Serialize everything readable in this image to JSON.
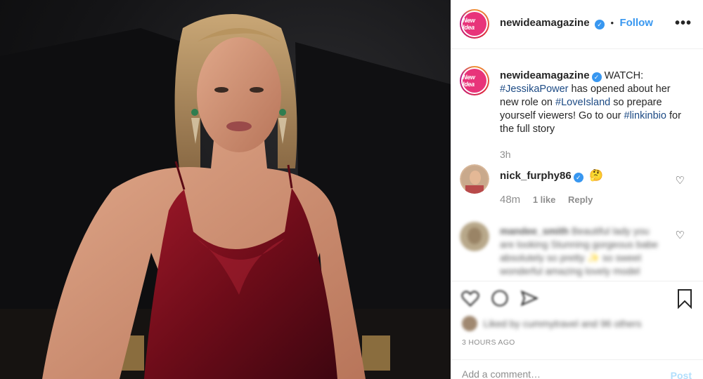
{
  "post": {
    "account": {
      "username": "newideamagazine",
      "avatar_text": "New Idea",
      "verified_icon": "verified-badge-icon",
      "follow_label": "Follow",
      "separator": "•"
    },
    "more_icon": "more-options-icon",
    "more_glyph": "•••",
    "caption": {
      "username": "newideamagazine",
      "text_1": "WATCH: ",
      "hashtag_1": "#JessikaPower",
      "text_2": " has opened about her new role on ",
      "hashtag_2": "#LoveIsland",
      "text_3": " so prepare yourself viewers! Go to our ",
      "hashtag_3": "#linkinbio",
      "text_4": " for the full story",
      "time": "3h"
    },
    "comments": [
      {
        "username": "nick_furphy86",
        "emoji": "🤔",
        "time": "48m",
        "likes": "1 like",
        "reply_label": "Reply"
      },
      {
        "username": "mandee_smith",
        "text": "Beautiful lady you are looking Stunning gorgeous babe absolutely so pretty ✨ so sweet wonderful amazing lovely model"
      }
    ],
    "liked_by_text": "Liked by cummytravel and 96 others",
    "posted_time": "3 HOURS AGO",
    "add_comment_placeholder": "Add a comment…",
    "post_label": "Post"
  },
  "colors": {
    "accent": "#3897f0",
    "hashtag": "#1c4a84",
    "muted": "#8e8e8e",
    "dress": "#7a0f1c"
  }
}
